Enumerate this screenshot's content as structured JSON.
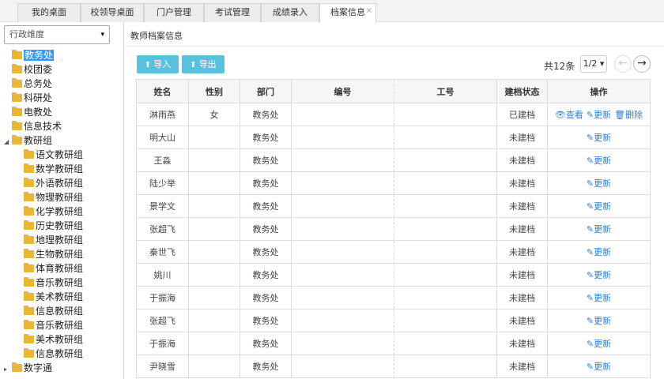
{
  "tabs": [
    {
      "label": "我的桌面"
    },
    {
      "label": "校领导桌面"
    },
    {
      "label": "门户管理"
    },
    {
      "label": "考试管理"
    },
    {
      "label": "成绩录入"
    },
    {
      "label": "档案信息",
      "active": true,
      "close": "×"
    }
  ],
  "sidebar": {
    "select_value": "行政维度",
    "select_caret": "▾",
    "tree": [
      {
        "label": "教务处",
        "selected": true,
        "depth": 0
      },
      {
        "label": "校团委",
        "depth": 0
      },
      {
        "label": "总务处",
        "depth": 0
      },
      {
        "label": "科研处",
        "depth": 0
      },
      {
        "label": "电教处",
        "depth": 0
      },
      {
        "label": "信息技术",
        "depth": 0
      },
      {
        "label": "教研组",
        "depth": 0,
        "expanded": true,
        "toggle": "◢"
      },
      {
        "label": "语文教研组",
        "depth": 1
      },
      {
        "label": "数学教研组",
        "depth": 1
      },
      {
        "label": "外语教研组",
        "depth": 1
      },
      {
        "label": "物理教研组",
        "depth": 1
      },
      {
        "label": "化学教研组",
        "depth": 1
      },
      {
        "label": "历史教研组",
        "depth": 1
      },
      {
        "label": "地理教研组",
        "depth": 1
      },
      {
        "label": "生物教研组",
        "depth": 1
      },
      {
        "label": "体育教研组",
        "depth": 1
      },
      {
        "label": "音乐教研组",
        "depth": 1
      },
      {
        "label": "美术教研组",
        "depth": 1
      },
      {
        "label": "信息教研组",
        "depth": 1
      },
      {
        "label": "音乐教研组",
        "depth": 1
      },
      {
        "label": "美术教研组",
        "depth": 1
      },
      {
        "label": "信息教研组",
        "depth": 1
      },
      {
        "label": "数字通",
        "depth": 0,
        "toggle": "▸"
      }
    ]
  },
  "main": {
    "breadcrumb": "教师档案信息",
    "import_label": "导入",
    "export_label": "导出",
    "upload_glyph": "⬆",
    "total": "共12条",
    "page_select": "1/2 ▾",
    "prev_glyph": "←",
    "next_glyph": "→",
    "columns": [
      "姓名",
      "性别",
      "部门",
      "编号",
      "工号",
      "建档状态",
      "操作"
    ],
    "actions": {
      "view": "👁查看",
      "update": "✎更新",
      "delete": "🗑删除"
    },
    "rows": [
      {
        "name": "淋雨燕",
        "gender": "女",
        "dept": "教务处",
        "number": "",
        "job_no": "",
        "status": "已建档",
        "ops": [
          "view",
          "update",
          "delete"
        ]
      },
      {
        "name": "明大山",
        "gender": "",
        "dept": "教务处",
        "number": "",
        "job_no": "",
        "status": "未建档",
        "ops": [
          "update"
        ]
      },
      {
        "name": "王淼",
        "gender": "",
        "dept": "教务处",
        "number": "",
        "job_no": "",
        "status": "未建档",
        "ops": [
          "update"
        ]
      },
      {
        "name": "陆少举",
        "gender": "",
        "dept": "教务处",
        "number": "",
        "job_no": "",
        "status": "未建档",
        "ops": [
          "update"
        ]
      },
      {
        "name": "景学文",
        "gender": "",
        "dept": "教务处",
        "number": "",
        "job_no": "",
        "status": "未建档",
        "ops": [
          "update"
        ]
      },
      {
        "name": "张超飞",
        "gender": "",
        "dept": "教务处",
        "number": "",
        "job_no": "",
        "status": "未建档",
        "ops": [
          "update"
        ]
      },
      {
        "name": "秦世飞",
        "gender": "",
        "dept": "教务处",
        "number": "",
        "job_no": "",
        "status": "未建档",
        "ops": [
          "update"
        ]
      },
      {
        "name": "姚川",
        "gender": "",
        "dept": "教务处",
        "number": "",
        "job_no": "",
        "status": "未建档",
        "ops": [
          "update"
        ]
      },
      {
        "name": "于振海",
        "gender": "",
        "dept": "教务处",
        "number": "",
        "job_no": "",
        "status": "未建档",
        "ops": [
          "update"
        ]
      },
      {
        "name": "张超飞",
        "gender": "",
        "dept": "教务处",
        "number": "",
        "job_no": "",
        "status": "未建档",
        "ops": [
          "update"
        ]
      },
      {
        "name": "于振海",
        "gender": "",
        "dept": "教务处",
        "number": "",
        "job_no": "",
        "status": "未建档",
        "ops": [
          "update"
        ]
      },
      {
        "name": "尹晓雪",
        "gender": "",
        "dept": "教务处",
        "number": "",
        "job_no": "",
        "status": "未建档",
        "ops": [
          "update"
        ]
      }
    ]
  }
}
